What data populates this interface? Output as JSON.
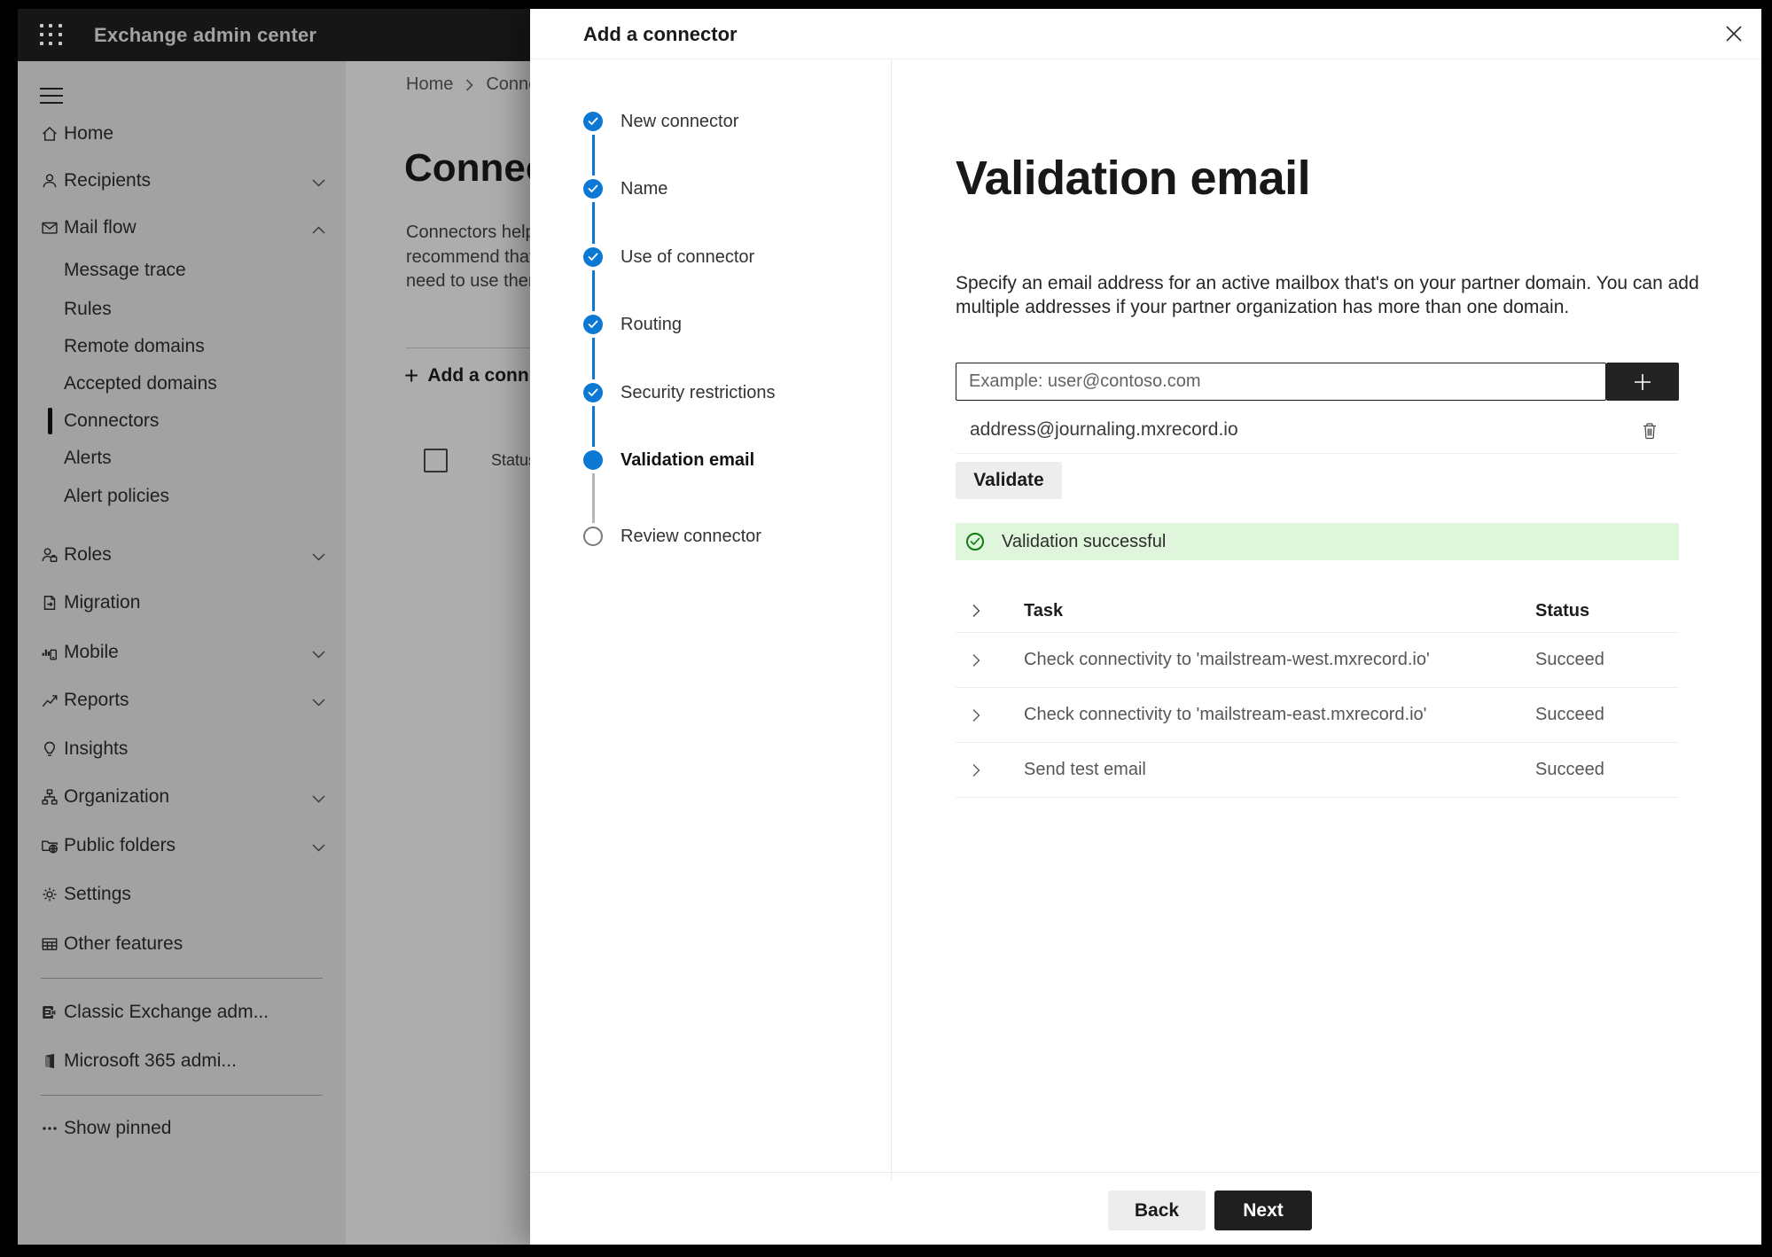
{
  "appbar": {
    "title": "Exchange admin center"
  },
  "sidebar": {
    "nav": [
      {
        "type": "item",
        "icon": "home",
        "label": "Home"
      },
      {
        "type": "item",
        "icon": "person",
        "label": "Recipients",
        "chevron": "down"
      },
      {
        "type": "item",
        "icon": "mail",
        "label": "Mail flow",
        "chevron": "up"
      },
      {
        "type": "subitem",
        "label": "Message trace"
      },
      {
        "type": "subitem",
        "label": "Rules"
      },
      {
        "type": "subitem",
        "label": "Remote domains"
      },
      {
        "type": "subitem",
        "label": "Accepted domains"
      },
      {
        "type": "subitem",
        "label": "Connectors",
        "selected": true
      },
      {
        "type": "subitem",
        "label": "Alerts"
      },
      {
        "type": "subitem",
        "label": "Alert policies"
      },
      {
        "type": "item",
        "icon": "roles",
        "label": "Roles",
        "chevron": "down"
      },
      {
        "type": "item",
        "icon": "migration",
        "label": "Migration"
      },
      {
        "type": "item",
        "icon": "mobile",
        "label": "Mobile",
        "chevron": "down"
      },
      {
        "type": "item",
        "icon": "reports",
        "label": "Reports",
        "chevron": "down"
      },
      {
        "type": "item",
        "icon": "insights",
        "label": "Insights"
      },
      {
        "type": "item",
        "icon": "organization",
        "label": "Organization",
        "chevron": "down"
      },
      {
        "type": "item",
        "icon": "public-folders",
        "label": "Public folders",
        "chevron": "down"
      },
      {
        "type": "item",
        "icon": "settings",
        "label": "Settings"
      },
      {
        "type": "item",
        "icon": "other-features",
        "label": "Other features"
      },
      {
        "type": "item",
        "icon": "classic-exchange",
        "label": "Classic Exchange adm..."
      },
      {
        "type": "item",
        "icon": "m365",
        "label": "Microsoft 365 admi..."
      },
      {
        "type": "item",
        "icon": "more",
        "label": "Show pinned"
      }
    ]
  },
  "background_page": {
    "breadcrumb_home": "Home",
    "breadcrumb_current": "Conne",
    "title": "Connec",
    "paragraph_lines": [
      "Connectors help",
      "recommend that",
      "need to use ther"
    ],
    "add_button_label": "Add a conn",
    "status_header": "Status"
  },
  "panel": {
    "title": "Add a connector",
    "steps": [
      {
        "label": "New connector",
        "state": "done"
      },
      {
        "label": "Name",
        "state": "done"
      },
      {
        "label": "Use of connector",
        "state": "done"
      },
      {
        "label": "Routing",
        "state": "done"
      },
      {
        "label": "Security restrictions",
        "state": "done"
      },
      {
        "label": "Validation email",
        "state": "current"
      },
      {
        "label": "Review connector",
        "state": "upcoming"
      }
    ],
    "content": {
      "heading": "Validation email",
      "description_lines": [
        "Specify an email address for an active mailbox that's on your partner domain. You can add",
        "multiple addresses if your partner organization has more than one domain."
      ],
      "input_placeholder": "Example: user@contoso.com",
      "address": "address@journaling.mxrecord.io",
      "validate_label": "Validate",
      "banner_text": "Validation successful",
      "table": {
        "task_header": "Task",
        "status_header": "Status",
        "rows": [
          {
            "task": "Check connectivity to 'mailstream-west.mxrecord.io'",
            "status": "Succeed"
          },
          {
            "task": "Check connectivity to 'mailstream-east.mxrecord.io'",
            "status": "Succeed"
          },
          {
            "task": "Send test email",
            "status": "Succeed"
          }
        ]
      },
      "back_label": "Back",
      "next_label": "Next"
    }
  },
  "colors": {
    "accent_blue": "#0b79d4",
    "success_green": "#107c10",
    "banner_bg": "#dff6dd",
    "primary_button_bg": "#1f1f1f"
  }
}
